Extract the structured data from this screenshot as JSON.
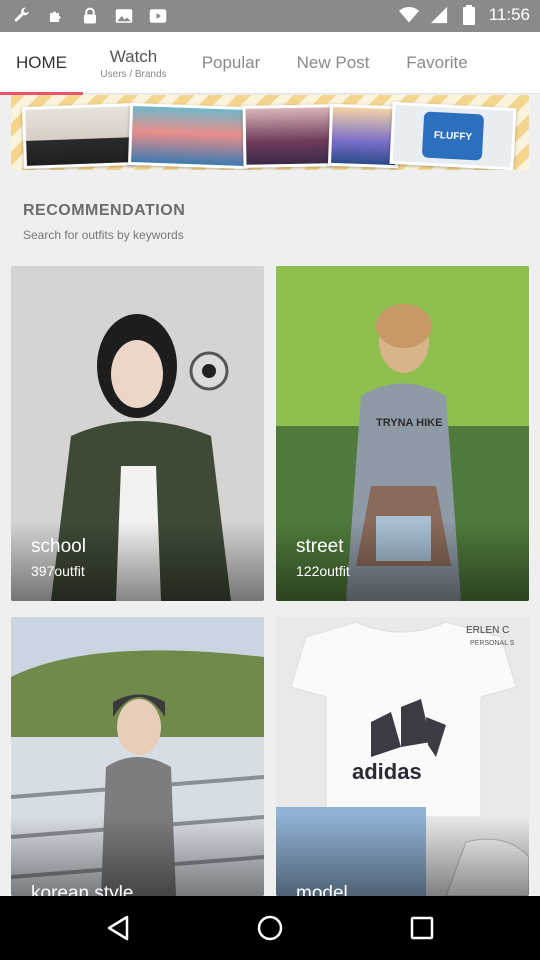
{
  "status": {
    "time": "11:56",
    "left_icons": [
      "wrench-icon",
      "puzzle-icon",
      "lock-icon",
      "image-icon",
      "play-icon"
    ],
    "right_icons": [
      "wifi-icon",
      "signal-icon",
      "battery-icon"
    ]
  },
  "tabs": [
    {
      "label": "HOME",
      "sub": ""
    },
    {
      "label": "Watch",
      "sub": "Users / Brands"
    },
    {
      "label": "Popular",
      "sub": ""
    },
    {
      "label": "New Post",
      "sub": ""
    },
    {
      "label": "Favorite",
      "sub": ""
    }
  ],
  "section": {
    "title": "RECOMMENDATION",
    "subtitle": "Search for outfits by keywords"
  },
  "cards": [
    {
      "name": "school",
      "count": "397outfit"
    },
    {
      "name": "street",
      "count": "122outfit"
    },
    {
      "name": "korean style",
      "count": ""
    },
    {
      "name": "model",
      "count": ""
    }
  ],
  "card_texts": {
    "tryna": "TRYNA HIKE",
    "brand": "adidas",
    "corner": "ERLEN C",
    "corner2": "PERSONAL S",
    "fluffy": "FLUFFY"
  },
  "nav": [
    "back-icon",
    "home-icon",
    "recents-icon"
  ],
  "colors": {
    "accent": "#e9546b",
    "statusbar": "#8a8a8a"
  }
}
